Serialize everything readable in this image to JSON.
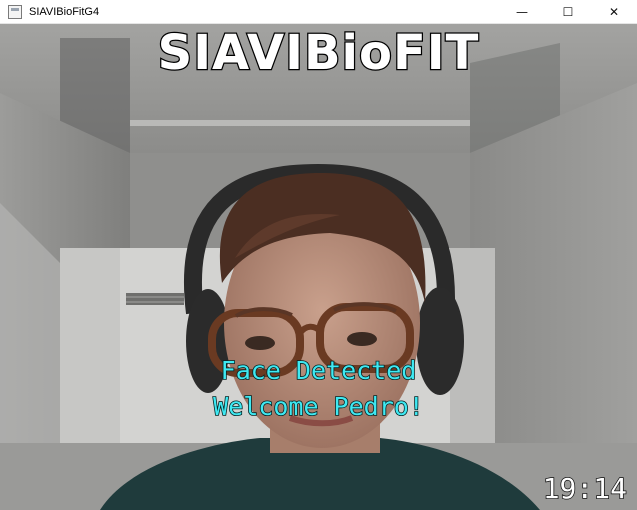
{
  "window": {
    "title": "SIAVIBioFitG4",
    "controls": {
      "minimize": "—",
      "maximize": "☐",
      "close": "✕"
    }
  },
  "overlay": {
    "brand": "SIAVIBioFIT",
    "status_line1": "Face Detected",
    "status_line2": "Welcome Pedro!",
    "clock": "19:14"
  },
  "colors": {
    "status_text": "#3fe9f2",
    "brand_text": "#ffffff",
    "clock_text": "#ffffff"
  },
  "icons": [
    "app-window-icon",
    "minimize-icon",
    "maximize-icon",
    "close-icon"
  ]
}
